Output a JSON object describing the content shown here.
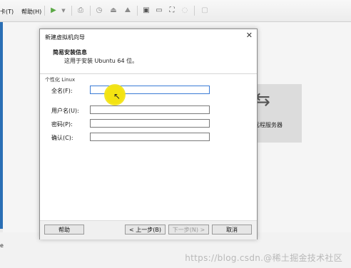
{
  "menubar": {
    "items": [
      "卡(T)",
      "帮助(H)"
    ],
    "icons": [
      "play-icon",
      "dropdown-icon",
      "network-icon",
      "snapshot-icon",
      "snapshot-restore-icon",
      "snapshot-manager-icon",
      "view-normal-icon",
      "view-console-icon",
      "view-fullscreen-icon",
      "view-unity-icon",
      "view-thumbnail-icon"
    ]
  },
  "background": {
    "tile_label": "远程服务器",
    "bottom_mark": "e",
    "watermark": "https://blog.csdn.@稀土掘金技术社区"
  },
  "dialog": {
    "title": "新建虚拟机向导",
    "header_title": "简易安装信息",
    "header_subtitle": "这用于安装 Ubuntu 64 位。",
    "group_label": "个性化 Linux",
    "fields": [
      {
        "label": "全名(F):",
        "value": ""
      },
      {
        "label": "用户名(U):",
        "value": ""
      },
      {
        "label": "密码(P):",
        "value": ""
      },
      {
        "label": "确认(C):",
        "value": ""
      }
    ],
    "buttons": {
      "help": "帮助",
      "back": "< 上一步(B)",
      "next": "下一步(N) >",
      "cancel": "取消"
    }
  },
  "colors": {
    "accent": "#3a7bd5",
    "cursor_highlight": "#f3e311",
    "tile": "#dcdcdc"
  }
}
